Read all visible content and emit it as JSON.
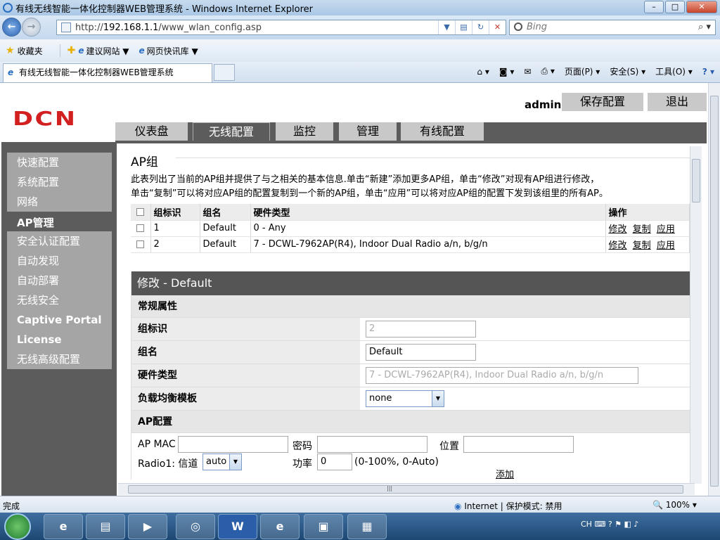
{
  "window": {
    "title": "有线无线智能一体化控制器WEB管理系统 - Windows Internet Explorer"
  },
  "address": {
    "prefix": "http://",
    "host": "192.168.1.1",
    "path": "/www_wlan_config.asp"
  },
  "search": {
    "placeholder": "Bing"
  },
  "favorites": {
    "label": "收藏夹",
    "items": [
      "建议网站 ▼",
      "网页快讯库 ▼"
    ]
  },
  "tab": {
    "label": "有线无线智能一体化控制器WEB管理系统"
  },
  "commandbar": {
    "page": "页面(P) ▾",
    "safety": "安全(S) ▾",
    "tools": "工具(O) ▾"
  },
  "header": {
    "logo": "DCN",
    "user": "admin",
    "save": "保存配置",
    "exit": "退出"
  },
  "nav": {
    "tabs": [
      "仪表盘",
      "无线配置",
      "监控",
      "管理",
      "有线配置"
    ],
    "active": 1
  },
  "sidebar": {
    "items": [
      "快速配置",
      "系统配置",
      "网络",
      "AP管理",
      "安全认证配置",
      "自动发现",
      "自动部署",
      "无线安全",
      "Captive Portal",
      "License",
      "无线高级配置"
    ]
  },
  "content": {
    "title": "AP组",
    "desc1": "此表列出了当前的AP组并提供了与之相关的基本信息.单击“新建”添加更多AP组，单击“修改”对现有AP组进行修改，",
    "desc2": "单击“复制”可以将对应AP组的配置复制到一个新的AP组，单击“应用”可以将对应AP组的配置下发到该组里的所有AP。",
    "table": {
      "headers": [
        "组标识",
        "组名",
        "硬件类型",
        "操作"
      ],
      "rows": [
        {
          "id": "1",
          "name": "Default",
          "hw": "0 - Any"
        },
        {
          "id": "2",
          "name": "Default",
          "hw": "7 - DCWL-7962AP(R4), Indoor Dual Radio a/n, b/g/n"
        }
      ],
      "actions": [
        "修改",
        "复制",
        "应用"
      ]
    },
    "form": {
      "heading": "修改 - Default",
      "general": "常规属性",
      "fields": {
        "id_label": "组标识",
        "id_value": "2",
        "name_label": "组名",
        "name_value": "Default",
        "hw_label": "硬件类型",
        "hw_value": "7 - DCWL-7962AP(R4), Indoor Dual Radio a/n, b/g/n",
        "lb_label": "负载均衡模板",
        "lb_value": "none"
      },
      "ap_section": "AP配置",
      "ap": {
        "mac_label": "AP MAC",
        "pwd_label": "密码",
        "loc_label": "位置",
        "radio1_label": "Radio1: 信道",
        "channel_value": "auto",
        "power_label": "功率",
        "power_value": "0",
        "power_hint": "(0-100%, 0-Auto)",
        "add": "添加"
      }
    }
  },
  "status": {
    "left": "完成",
    "zone": "Internet | 保护模式: 禁用",
    "zoom": "100%"
  },
  "taskbar": {
    "tray": "CH"
  }
}
